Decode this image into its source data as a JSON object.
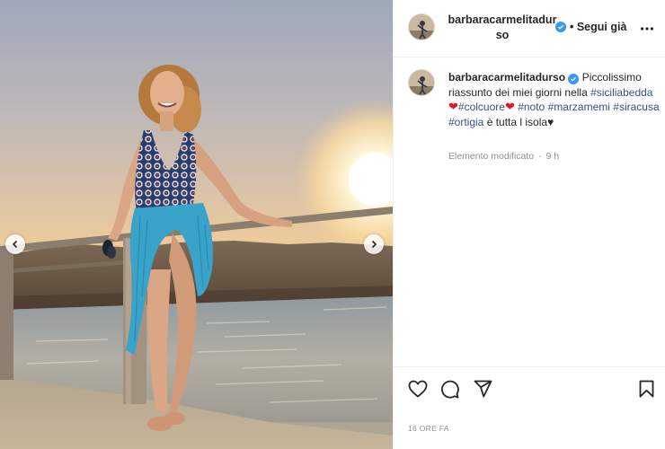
{
  "post": {
    "username": "barbaracarmelitadurso",
    "follow_label": "• Segui già",
    "caption": {
      "username": "barbaracarmelitadurso",
      "text_1": "Piccolissimo riassunto dei miei giorni nella",
      "tags_line": [
        "#siciliabedda",
        "#colcuore",
        "#noto",
        "#marzamemi",
        "#siracusa",
        "#ortigia"
      ],
      "heart": "❤",
      "text_2": "è tutta l isola",
      "small_heart": "♥"
    },
    "edited_label": "Elemento modificato",
    "edited_dot": "·",
    "edited_time": "9 h",
    "timestamp": "16 ORE FA"
  },
  "icons": {
    "more": "more-options-icon",
    "like": "heart-icon",
    "comment": "comment-icon",
    "share": "paper-plane-icon",
    "save": "bookmark-icon",
    "verified": "verified-badge-icon",
    "prev": "chevron-left-icon",
    "next": "chevron-right-icon"
  },
  "colors": {
    "verified": "#3897f0",
    "hashtag": "#385185",
    "heart_emoji": "#e0162b",
    "muted": "#8e8e8e"
  }
}
